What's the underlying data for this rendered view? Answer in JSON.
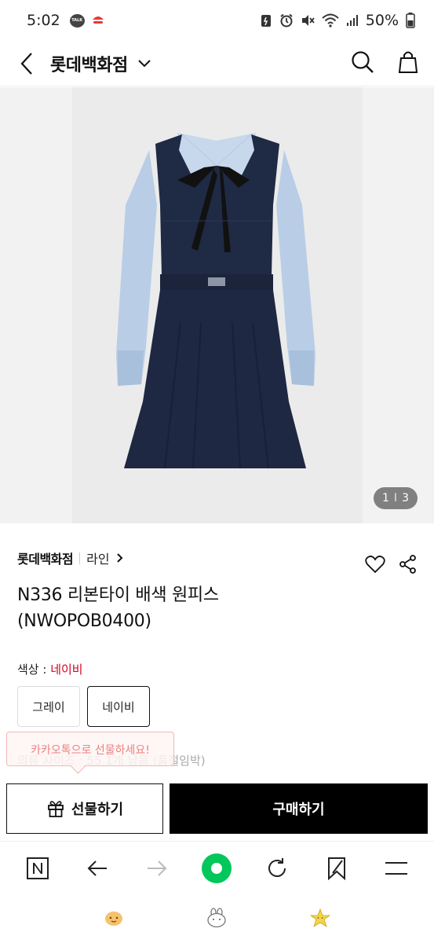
{
  "status_bar": {
    "time": "5:02",
    "talk_badge": "TALK",
    "battery": "50%"
  },
  "header": {
    "title": "롯데백화점",
    "icons": [
      "back-arrow-icon",
      "chevron-down-icon",
      "search-icon",
      "shopping-bag-icon"
    ]
  },
  "product_image": {
    "page_current": "1",
    "page_separator": "I",
    "page_total": "3"
  },
  "product": {
    "brand": "롯데백화점",
    "line": "라인",
    "name": "N336 리본타이 배색 원피스 (NWOPOB0400)",
    "color_label": "색상 : ",
    "color_value": "네이비",
    "colors": [
      "그레이",
      "네이비"
    ],
    "selected_color_index": 1,
    "size_text": "의류 사이즈 : 55 1개 남음 (품절임박)",
    "kakao_tooltip": "카카오톡으로 선물하세요!"
  },
  "actions": {
    "gift_label": "선물하기",
    "buy_label": "구매하기"
  },
  "colors": {
    "accent_red": "#d0021b",
    "naver_green": "#03c75a",
    "buy_button": "#000000"
  }
}
